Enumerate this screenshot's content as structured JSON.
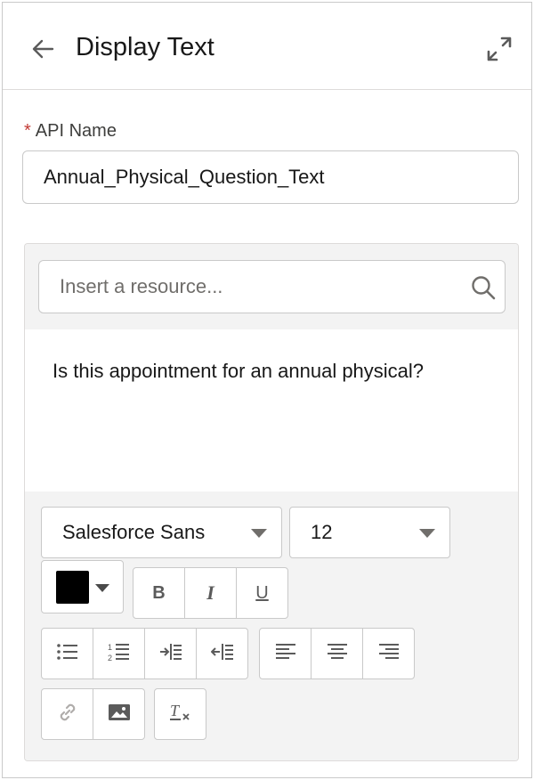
{
  "header": {
    "title": "Display Text"
  },
  "api_name": {
    "label": "API Name",
    "required_marker": "*",
    "value": "Annual_Physical_Question_Text"
  },
  "editor": {
    "resource_placeholder": "Insert a resource...",
    "content": "Is this appointment for an annual physical?",
    "font_family_value": "Salesforce Sans",
    "font_size_value": "12",
    "text_color": "#000000",
    "format_labels": {
      "bold": "B",
      "italic": "I",
      "underline": "U"
    }
  },
  "icons": [
    "back-arrow-icon",
    "expand-icon",
    "search-icon",
    "bulleted-list-icon",
    "numbered-list-icon",
    "indent-icon",
    "outdent-icon",
    "align-left-icon",
    "align-center-icon",
    "align-right-icon",
    "link-icon",
    "image-icon",
    "clear-formatting-icon"
  ]
}
